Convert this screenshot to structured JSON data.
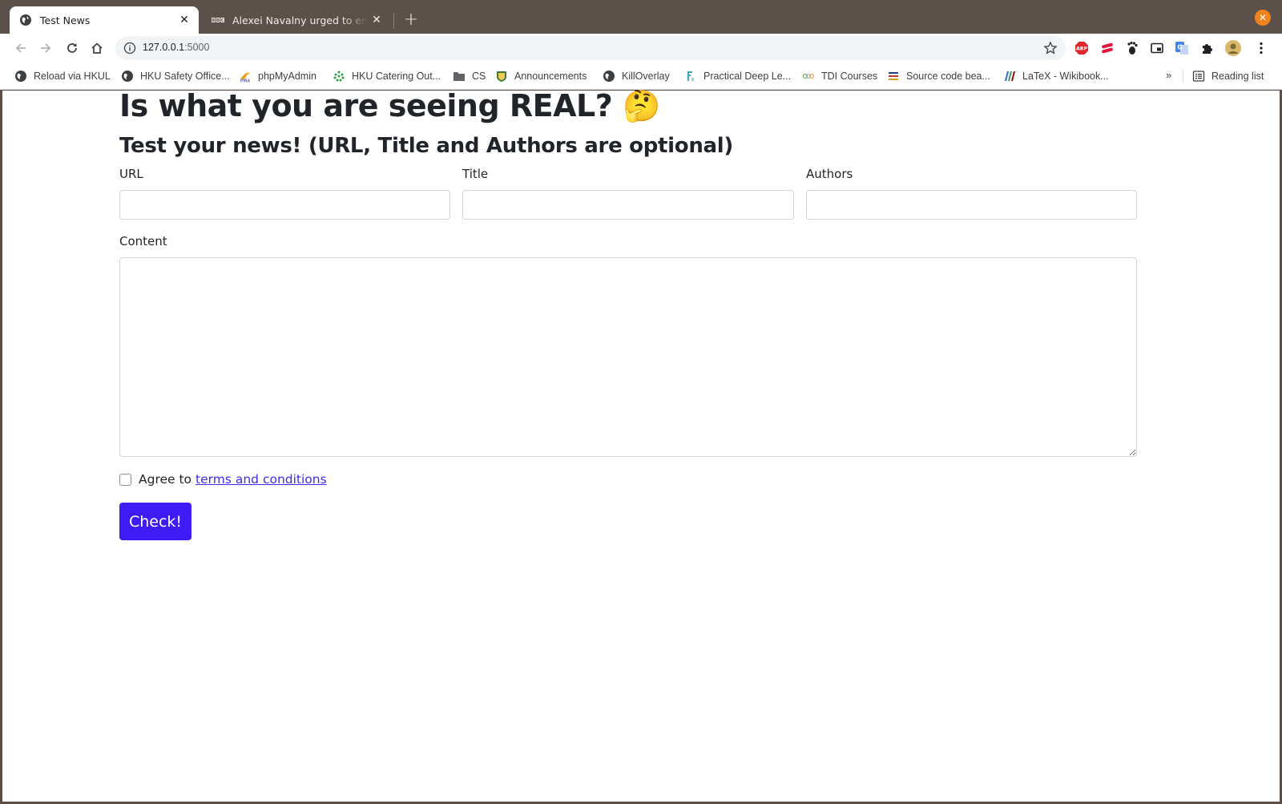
{
  "browser": {
    "tabs": [
      {
        "title": "Test News",
        "icon": "globe-icon",
        "active": true
      },
      {
        "title": "Alexei Navalny urged to end hunger strike",
        "icon": "bbc-icon",
        "active": false
      }
    ],
    "new_tab_label": "+",
    "address": {
      "host": "127.0.0.1",
      "port": ":5000"
    },
    "bookmarks": [
      {
        "label": "Reload via HKUL",
        "icon": "globe-icon"
      },
      {
        "label": "HKU Safety Office...",
        "icon": "globe-icon"
      },
      {
        "label": "phpMyAdmin",
        "icon": "phpmyadmin-icon"
      },
      {
        "label": "HKU Catering Out...",
        "icon": "leaf-icon"
      },
      {
        "label": "CS",
        "icon": "folder-icon"
      },
      {
        "label": "Announcements",
        "icon": "shield-icon"
      },
      {
        "label": "KillOverlay",
        "icon": "globe-icon"
      },
      {
        "label": "Practical Deep Le...",
        "icon": "fastai-icon"
      },
      {
        "label": "TDI Courses",
        "icon": "tdi-icon"
      },
      {
        "label": "Source code bea...",
        "icon": "stripes-icon"
      },
      {
        "label": "LaTeX - Wikibook...",
        "icon": "wikibooks-icon"
      }
    ],
    "more_bookmarks": "»",
    "reading_list": "Reading list"
  },
  "page": {
    "headline": "Is what you are seeing REAL? 🤔",
    "subhead": "Test your news! (URL, Title and Authors are optional)",
    "fields": {
      "url_label": "URL",
      "title_label": "Title",
      "authors_label": "Authors",
      "content_label": "Content"
    },
    "agree_prefix": "Agree to",
    "terms_link": "terms and conditions",
    "submit_label": "Check!"
  },
  "colors": {
    "frame": "#5a4e47",
    "accent_button": "#3f1cf5",
    "link": "#3d2bf0",
    "close_button": "#f0831e"
  }
}
